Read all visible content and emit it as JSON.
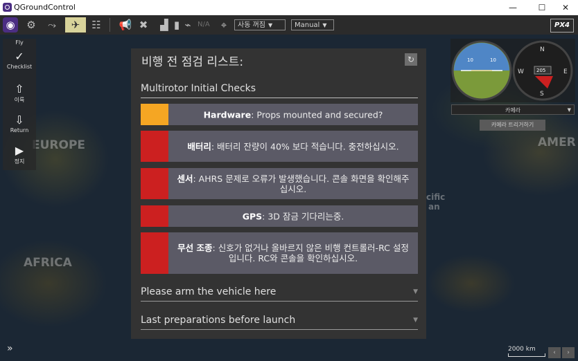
{
  "window": {
    "title": "QGroundControl",
    "minimize_label": "—",
    "maximize_label": "☐",
    "close_label": "✕"
  },
  "toolbar": {
    "gps_status": "N/A",
    "flight_mode_dropdown": "사동 꺼짐",
    "mode_dropdown": "Manual",
    "brand": "PX4"
  },
  "left_panel": {
    "fly_label": "Fly",
    "checklist_label": "Checklist",
    "takeoff_label": "이륙",
    "return_label": "Return",
    "stop_label": "정지"
  },
  "map": {
    "labels": [
      {
        "text": "EUROPE"
      },
      {
        "text": "AFRICA"
      },
      {
        "text": "AMER"
      },
      {
        "text": "cific"
      },
      {
        "text": "an"
      }
    ],
    "scale_label": "2000 km"
  },
  "checklist": {
    "title": "비행 전 점검 리스트:",
    "section_title": "Multirotor Initial Checks",
    "items": [
      {
        "name": "Hardware",
        "message": "Props mounted and secured?",
        "status": "pending",
        "status_color": "#f5a623"
      },
      {
        "name": "배터리",
        "message": "배터리 잔량이 40% 보다 적습니다. 충전하십시오.",
        "status": "failed",
        "status_color": "#cc2020"
      },
      {
        "name": "센서",
        "message": "AHRS 문제로 오류가 발생했습니다. 콘솔 화면을 확인해주십시오.",
        "status": "failed",
        "status_color": "#cc2020"
      },
      {
        "name": "GPS",
        "message": "3D 잠금 기다리는중.",
        "status": "failed",
        "status_color": "#cc2020"
      },
      {
        "name": "무선 조종",
        "message": "신호가 없거나 올바르지 않은 비행 컨트롤러-RC 설정입니다. RC와 콘솔을 확인하십시오.",
        "status": "failed",
        "status_color": "#cc2020"
      }
    ],
    "collapsed_sections": [
      {
        "label": "Please arm the vehicle here"
      },
      {
        "label": "Last preparations before launch"
      }
    ]
  },
  "instruments": {
    "attitude_marks": [
      "10",
      "10"
    ],
    "compass_marks": [
      "N",
      "S",
      "E",
      "W"
    ],
    "heading": "205"
  },
  "camera": {
    "dropdown_label": "카메라",
    "trigger_button": "카메라 트리거하기"
  },
  "colors": {
    "accent": "#d8d39a",
    "panel_bg": "#333333",
    "item_bg": "#5b5a66",
    "pending": "#f5a623",
    "failed": "#cc2020"
  }
}
